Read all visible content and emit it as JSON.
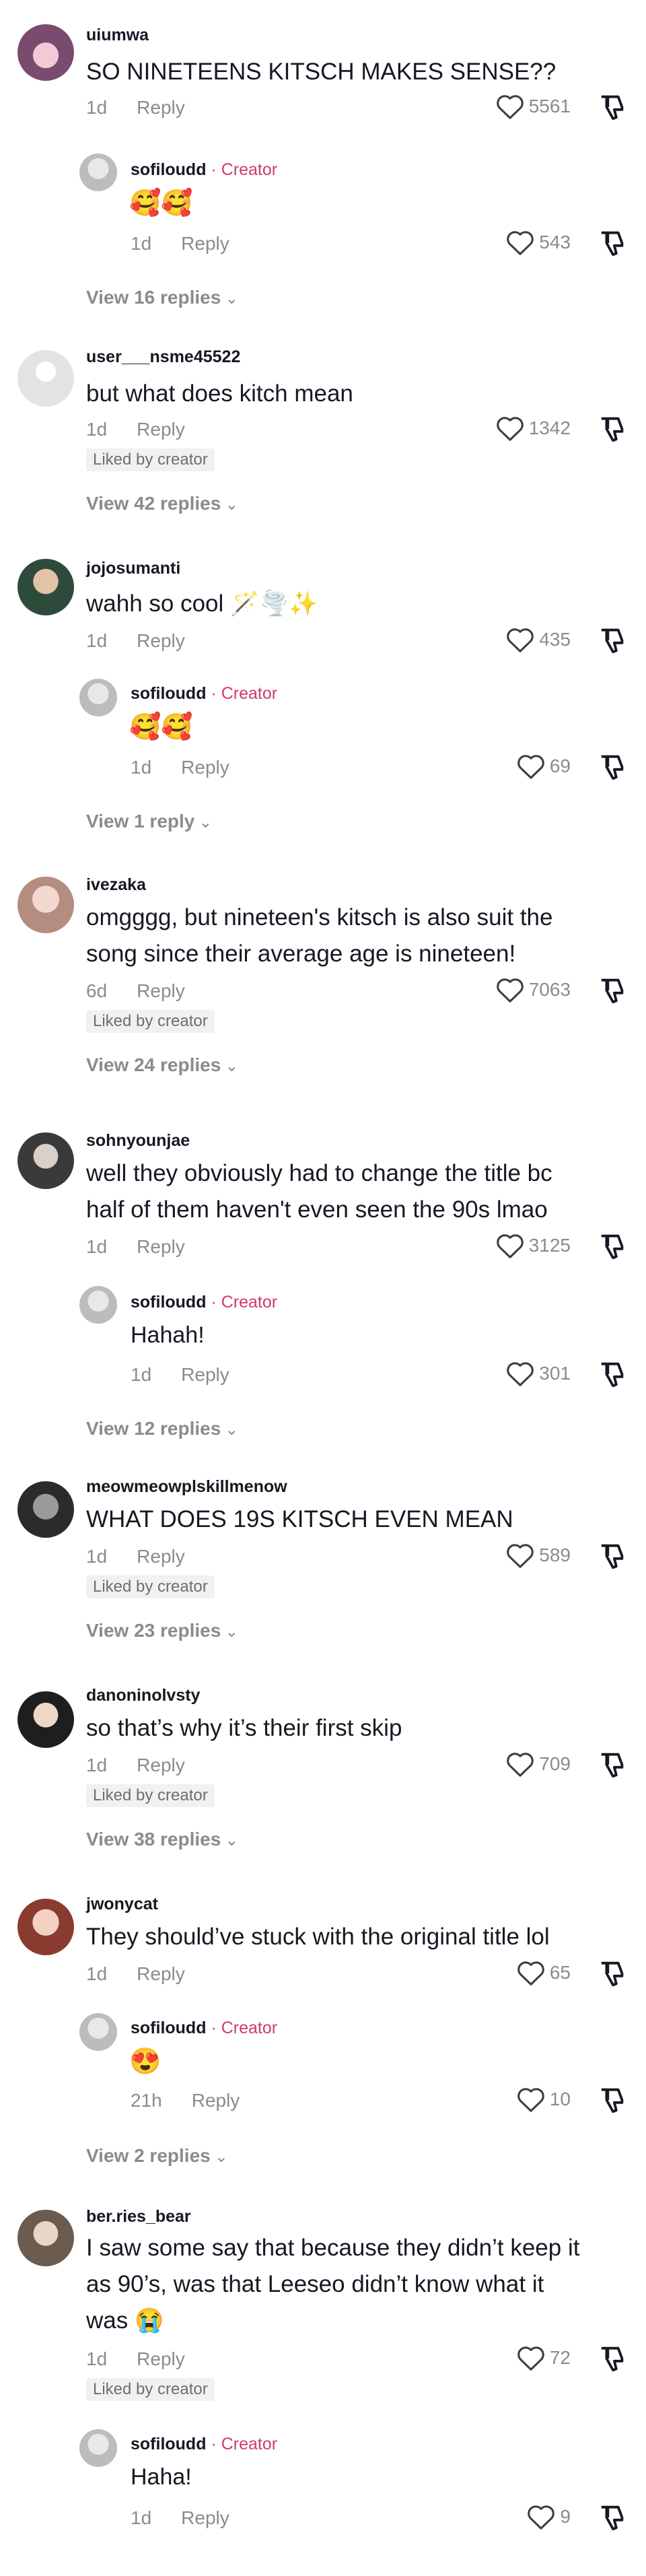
{
  "ui": {
    "reply_label": "Reply",
    "creator_label": "· Creator",
    "liked_by_creator": "Liked by creator",
    "colors": {
      "text": "#161823",
      "muted": "#8a8b91",
      "creator": "#d03a67",
      "badge_bg": "#f1f1f2"
    },
    "icons": {
      "like": "heart-outline-icon",
      "dislike": "thumbs-down-icon",
      "expand": "chevron-down-icon"
    }
  },
  "comments": [
    {
      "username": "uiumwa",
      "text": "SO NINETEENS KITSCH MAKES SENSE??",
      "time": "1d",
      "likes": "5561",
      "reply": {
        "username": "sofiloudd",
        "text": "🥰🥰",
        "time": "1d",
        "likes": "543"
      },
      "view_replies": "View 16 replies"
    },
    {
      "username": "user___nsme45522",
      "text": "but what does kitch mean",
      "time": "1d",
      "likes": "1342",
      "view_replies": "View 42 replies"
    },
    {
      "username": "jojosumanti",
      "text": "wahh so cool 🪄🌪️✨",
      "time": "1d",
      "likes": "435",
      "reply": {
        "username": "sofiloudd",
        "text": "🥰🥰",
        "time": "1d",
        "likes": "69"
      },
      "view_replies": "View 1 reply"
    },
    {
      "username": "ivezaka",
      "text": "omgggg, but nineteen's kitsch is also suit the song since their average age is nineteen!",
      "time": "6d",
      "likes": "7063",
      "view_replies": "View 24 replies"
    },
    {
      "username": "sohnyounjae",
      "text": "well they obviously had to change the title bc half of them haven't even seen the 90s lmao",
      "time": "1d",
      "likes": "3125",
      "reply": {
        "username": "sofiloudd",
        "text": "Hahah!",
        "time": "1d",
        "likes": "301"
      },
      "view_replies": "View 12 replies"
    },
    {
      "username": "meowmeowplskillmenow",
      "text": "WHAT DOES 19S KITSCH EVEN MEAN",
      "time": "1d",
      "likes": "589",
      "view_replies": "View 23 replies"
    },
    {
      "username": "danoninolvsty",
      "text": "so that’s why it’s their first skip",
      "time": "1d",
      "likes": "709",
      "view_replies": "View 38 replies"
    },
    {
      "username": "jwonycat",
      "text": "They should’ve stuck with the original title lol",
      "time": "1d",
      "likes": "65",
      "reply": {
        "username": "sofiloudd",
        "text": "😍",
        "time": "21h",
        "likes": "10"
      },
      "view_replies": "View 2 replies"
    },
    {
      "username": "ber.ries_bear",
      "text": "I saw some say that because they didn’t keep it as 90’s, was that Leeseo didn’t know what it was 😭",
      "time": "1d",
      "likes": "72",
      "reply": {
        "username": "sofiloudd",
        "text": "Haha!",
        "time": "1d",
        "likes": "9"
      }
    }
  ]
}
